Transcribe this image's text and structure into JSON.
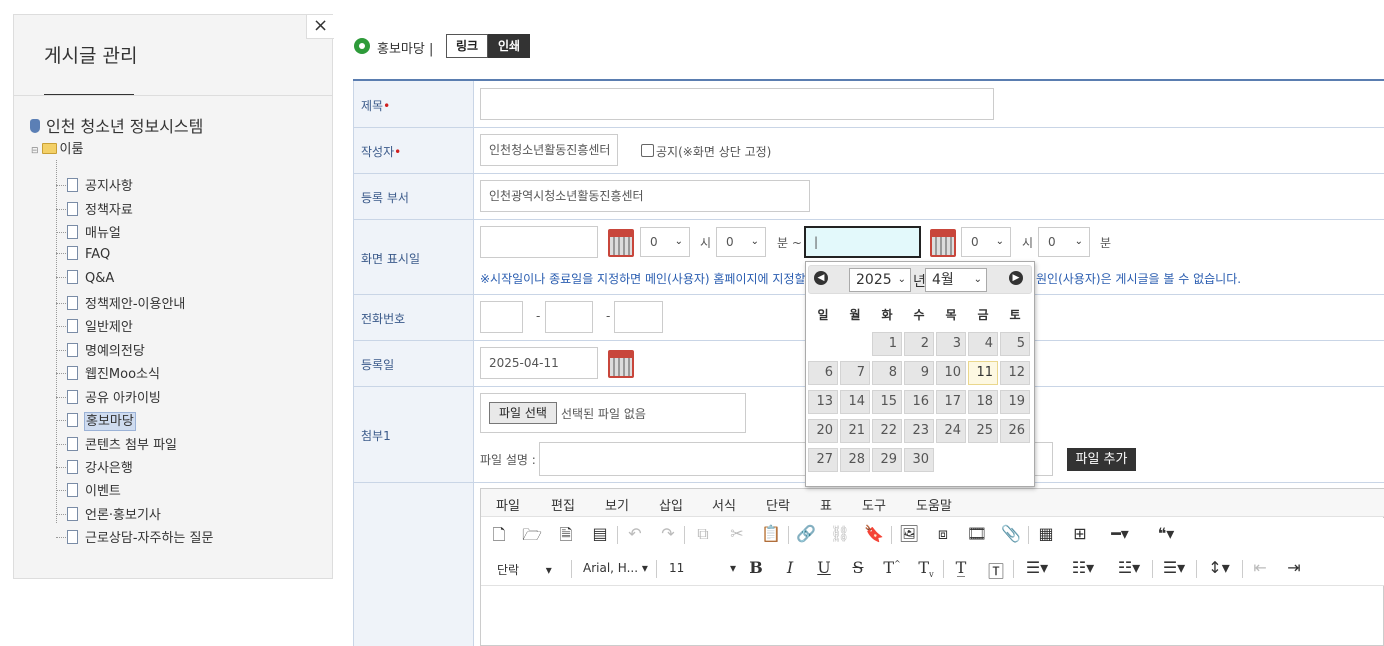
{
  "sidebar": {
    "title": "게시글 관리",
    "close_label": "×",
    "root_label": "인천 청소년 정보시스템",
    "folder_label": "이룸",
    "items": [
      "공지사항",
      "정책자료",
      "매뉴얼",
      "FAQ",
      "Q&A",
      "정책제안-이용안내",
      "일반제안",
      "명예의전당",
      "웹진Moo소식",
      "공유 아카이빙",
      "홍보마당",
      "콘텐츠 첨부 파일",
      "강사은행",
      "이벤트",
      "언론·홍보기사",
      "근로상담-자주하는 질문"
    ],
    "selected_item": "홍보마당"
  },
  "header": {
    "title": "홍보마당 |",
    "link_button": "링크",
    "print_button": "인쇄"
  },
  "form": {
    "subject_label": "제목",
    "author_label": "작성자",
    "author_value": "인천청소년활동진흥센터",
    "notice_label": "공지(※화면 상단 고정)",
    "dept_label": "등록 부서",
    "dept_value": "인천광역시청소년활동진흥센터",
    "display_label": "화면 표시일",
    "start_hour": "0",
    "start_min": "0",
    "end_hour": "0",
    "end_min": "0",
    "hour_unit": "시",
    "min_unit": "분",
    "min_unit_tilde": "분 ~",
    "end_date_value": "|",
    "display_note": "※시작일이나 종료일을 지정하면 메인(사용자) 홈페이지에 지정할",
    "display_note_right": "원인(사용자)은 게시글을 볼 수 없습니다.",
    "phone_label": "전화번호",
    "phone_dash": "-",
    "regdate_label": "등록일",
    "regdate_value": "2025-04-11",
    "attach_label": "첨부1",
    "file_button": "파일 선택",
    "file_none": "선택된 파일 없음",
    "file_desc_label": "파일 설명 :",
    "file_add_button": "파일 추가",
    "required_mark": "•"
  },
  "editor": {
    "menus": [
      "파일",
      "편집",
      "보기",
      "삽입",
      "서식",
      "단락",
      "표",
      "도구",
      "도움말"
    ],
    "block_format": "단락",
    "font_family": "Arial, H...",
    "font_size": "11"
  },
  "datepicker": {
    "year": "2025",
    "year_suffix": "년",
    "month": "4월",
    "weekdays": [
      "일",
      "월",
      "화",
      "수",
      "목",
      "금",
      "토"
    ],
    "days": [
      "1",
      "2",
      "3",
      "4",
      "5",
      "6",
      "7",
      "8",
      "9",
      "10",
      "11",
      "12",
      "13",
      "14",
      "15",
      "16",
      "17",
      "18",
      "19",
      "20",
      "21",
      "22",
      "23",
      "24",
      "25",
      "26",
      "27",
      "28",
      "29",
      "30"
    ],
    "today": "11",
    "prev_label": "◀",
    "next_label": "▶"
  },
  "colors": {
    "accent_blue": "#2a5db0",
    "label_bg": "#eff3f9",
    "dark_button": "#333333",
    "required": "#d02020"
  }
}
